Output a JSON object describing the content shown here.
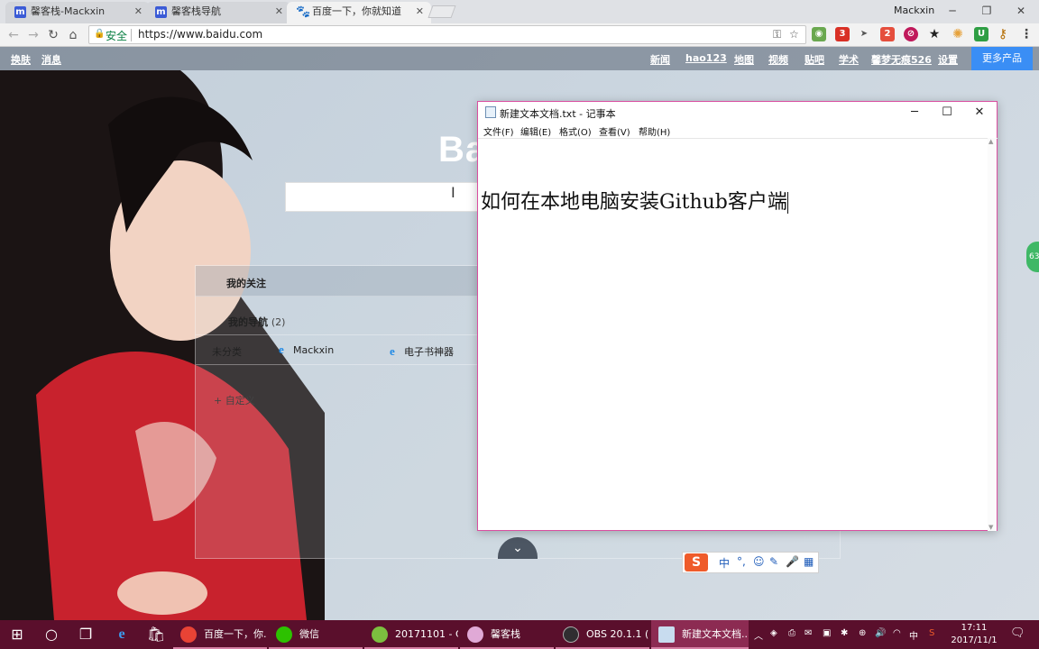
{
  "browser": {
    "tabs": [
      {
        "label": "馨客栈-Mackxin",
        "icon": "m-logo-icon"
      },
      {
        "label": "馨客栈导航",
        "icon": "m-logo-icon"
      },
      {
        "label": "百度一下，你就知道",
        "icon": "baidu-paw-icon",
        "active": true
      }
    ],
    "profile_name": "Mackxin",
    "secure_label": "安全",
    "url": "https://www.baidu.com",
    "extension_badges": [
      "3",
      "2"
    ]
  },
  "baidu": {
    "top_left_links": [
      "换肤",
      "消息"
    ],
    "top_right_links": [
      "新闻",
      "hao123",
      "地图",
      "视频",
      "贴吧",
      "学术",
      "馨梦无痕526",
      "设置"
    ],
    "more_products": "更多产品",
    "logo_text": "Ba",
    "nav_panel": {
      "my_follow": "我的关注",
      "my_nav": "我的导航",
      "my_nav_count": "(2)",
      "category": "未分类",
      "links": [
        "Mackxin",
        "电子书神器"
      ],
      "custom": "+ 自定义"
    },
    "side_badge": "63"
  },
  "notepad": {
    "title": "新建文本文档.txt - 记事本",
    "menus": [
      "文件(F)",
      "编辑(E)",
      "格式(O)",
      "查看(V)",
      "帮助(H)"
    ],
    "content": "如何在本地电脑安装Github客户端"
  },
  "ime": {
    "items": [
      "中",
      "°,",
      "☺",
      "✎",
      "🎤",
      "▦"
    ]
  },
  "taskbar": {
    "apps": [
      {
        "label": "百度一下，你...",
        "icon_color": "#e84335"
      },
      {
        "label": "微信",
        "icon_color": "#2dc100"
      },
      {
        "label": "20171101 - C...",
        "icon_color": "#7cbf3f"
      },
      {
        "label": "馨客栈",
        "icon_color": "#e0a9d6"
      },
      {
        "label": "OBS 20.1.1 (...",
        "icon_color": "#302e31"
      },
      {
        "label": "新建文本文档...",
        "icon_color": "#c8dcef",
        "active": true
      }
    ],
    "tray_lang": "中",
    "time": "17:11",
    "date": "2017/11/1"
  }
}
